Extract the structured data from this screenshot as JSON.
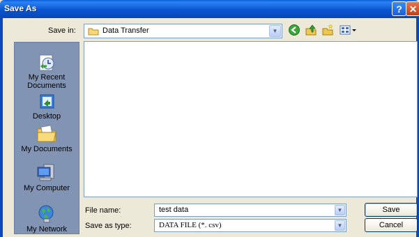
{
  "window": {
    "title": "Save As"
  },
  "save_in": {
    "label": "Save in:",
    "value": "Data Transfer"
  },
  "places": [
    {
      "label": "My Recent Documents",
      "icon": "recent-documents-icon"
    },
    {
      "label": "Desktop",
      "icon": "desktop-icon"
    },
    {
      "label": "My Documents",
      "icon": "my-documents-icon"
    },
    {
      "label": "My Computer",
      "icon": "my-computer-icon"
    },
    {
      "label": "My Network",
      "icon": "my-network-icon"
    }
  ],
  "file_name": {
    "label": "File name:",
    "value": "test data"
  },
  "save_as_type": {
    "label": "Save as type:",
    "value": "DATA FILE (*. csv)"
  },
  "buttons": {
    "save": "Save",
    "cancel": "Cancel",
    "help": "?",
    "close": "✕"
  },
  "colors": {
    "titlebar": "#0b55d0",
    "dialog_bg": "#ece9d8",
    "places_bar": "#8294b4",
    "close": "#c63f16"
  }
}
